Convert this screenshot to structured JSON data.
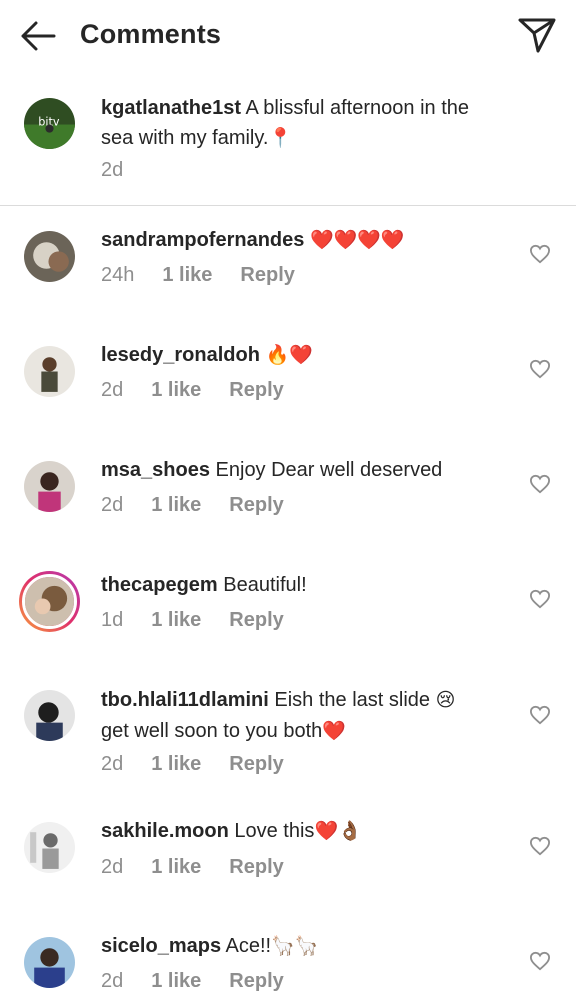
{
  "header": {
    "title": "Comments"
  },
  "caption": {
    "username": "kgatlanathe1st",
    "text": "A blissful afternoon in the sea with my family.",
    "emoji": "📍",
    "time": "2d"
  },
  "comments": [
    {
      "username": "sandrampofernandes",
      "text": "",
      "emoji": "❤️❤️❤️❤️",
      "time": "24h",
      "likes": "1 like",
      "reply": "Reply"
    },
    {
      "username": "lesedy_ronaldoh",
      "text": "",
      "emoji": "🔥❤️",
      "time": "2d",
      "likes": "1 like",
      "reply": "Reply"
    },
    {
      "username": "msa_shoes",
      "text": "Enjoy Dear well deserved",
      "emoji": "",
      "time": "2d",
      "likes": "1 like",
      "reply": "Reply"
    },
    {
      "username": "thecapegem",
      "text": "Beautiful!",
      "emoji": "",
      "time": "1d",
      "likes": "1 like",
      "reply": "Reply"
    },
    {
      "username": "tbo.hlali11dlamini",
      "text": "Eish the last slide",
      "emoji": "😢",
      "text2": "get well soon to you both",
      "emoji2": "❤️",
      "time": "2d",
      "likes": "1 like",
      "reply": "Reply"
    },
    {
      "username": "sakhile.moon",
      "text": "Love this",
      "emoji": "❤️👌🏾",
      "time": "2d",
      "likes": "1 like",
      "reply": "Reply"
    },
    {
      "username": "sicelo_maps",
      "text": "Ace!!",
      "emoji": "🦙🦙",
      "time": "2d",
      "likes": "1 like",
      "reply": "Reply"
    }
  ],
  "icons": {
    "back": "arrow-left-icon",
    "send": "paper-plane-icon",
    "like": "heart-outline-icon"
  }
}
